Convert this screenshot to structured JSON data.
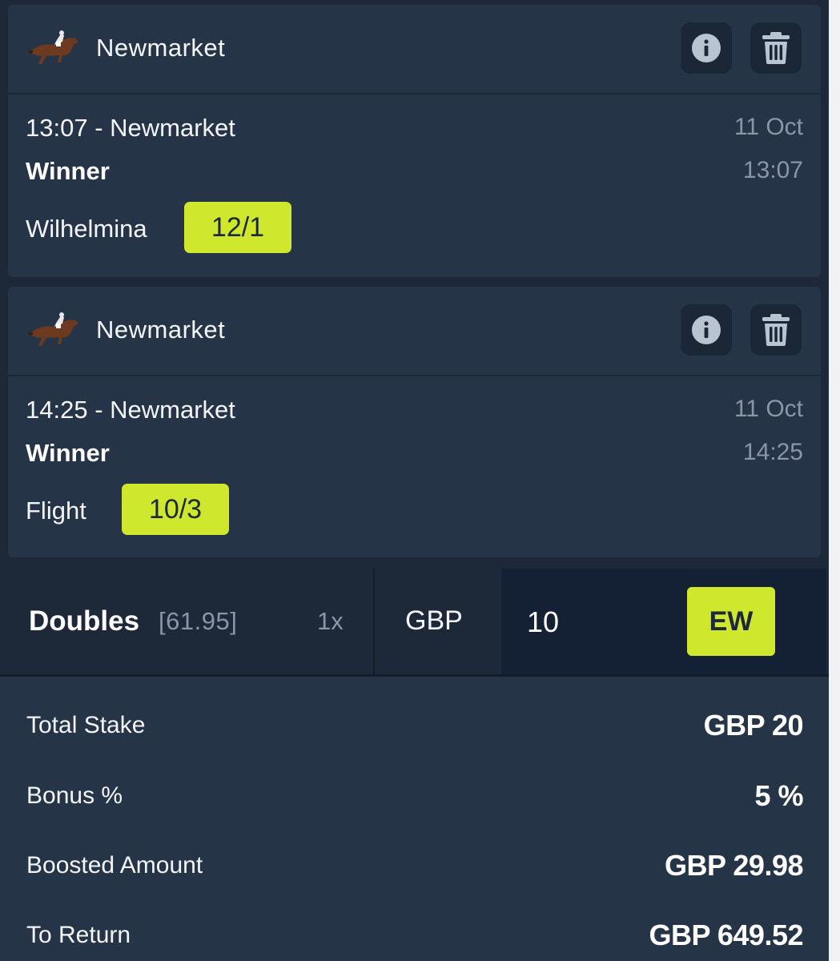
{
  "colors": {
    "background": "#1d2838",
    "card": "#263447",
    "accent": "#cfe82e",
    "muted_text": "#8a96a8",
    "caret": "#2f7cf6"
  },
  "selections": [
    {
      "venue": "Newmarket",
      "horse_icon": "horse-racing-icon",
      "race_title": "13:07 - Newmarket",
      "date": "11 Oct",
      "market": "Winner",
      "time": "13:07",
      "selection": "Wilhelmina",
      "odds": "12/1"
    },
    {
      "venue": "Newmarket",
      "horse_icon": "horse-racing-icon",
      "race_title": "14:25 - Newmarket",
      "date": "11 Oct",
      "market": "Winner",
      "time": "14:25",
      "selection": "Flight",
      "odds": "10/3"
    }
  ],
  "bet": {
    "type_label": "Doubles",
    "combined_odds": "[61.95]",
    "multiplier": "1x",
    "currency": "GBP",
    "stake_value": "10",
    "ew_label": "EW"
  },
  "summary": {
    "total_stake_label": "Total Stake",
    "total_stake_value": "GBP 20",
    "bonus_label": "Bonus %",
    "bonus_value": "5 %",
    "boosted_label": "Boosted Amount",
    "boosted_value": "GBP 29.98",
    "return_label": "To Return",
    "return_value": "GBP 649.52"
  }
}
